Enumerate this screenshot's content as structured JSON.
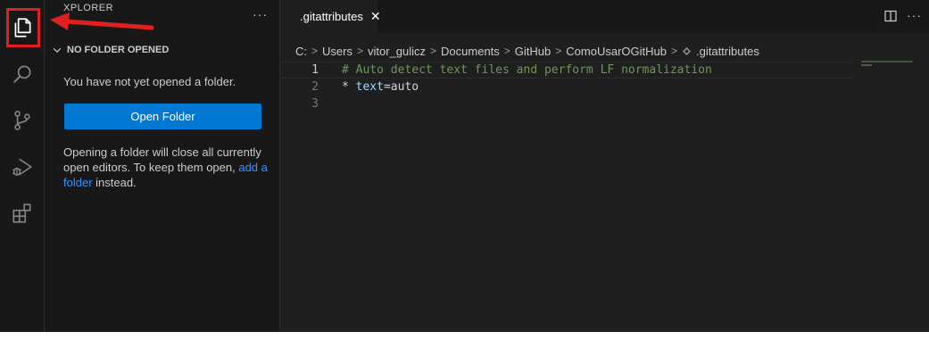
{
  "sidebar": {
    "title": "XPLORER",
    "more": "···",
    "section_title": "NO FOLDER OPENED",
    "empty_message": "You have not yet opened a folder.",
    "open_folder_label": "Open Folder",
    "hint_before": "Opening a folder will close all currently open editors. To keep them open, ",
    "hint_link": "add a folder",
    "hint_after": " instead."
  },
  "activity_bar": {
    "items": [
      "files-icon",
      "search-icon",
      "source-control-icon",
      "run-debug-icon",
      "extensions-icon"
    ]
  },
  "editor": {
    "tab_label": ".gitattributes",
    "tab_close": "✕",
    "more": "···",
    "breadcrumb": [
      "C:",
      "Users",
      "vitor_gulicz",
      "Documents",
      "GitHub",
      "ComoUsarOGitHub",
      ".gitattributes"
    ],
    "lines": [
      {
        "number": "1",
        "comment": "# Auto detect text files and perform LF normalization"
      },
      {
        "number": "2",
        "op": "* ",
        "key": "text",
        "rest": "=auto"
      },
      {
        "number": "3"
      }
    ]
  },
  "colors": {
    "accent": "#0078d4",
    "highlight": "#e0201e",
    "comment": "#6a9955",
    "link": "#3794ff"
  }
}
